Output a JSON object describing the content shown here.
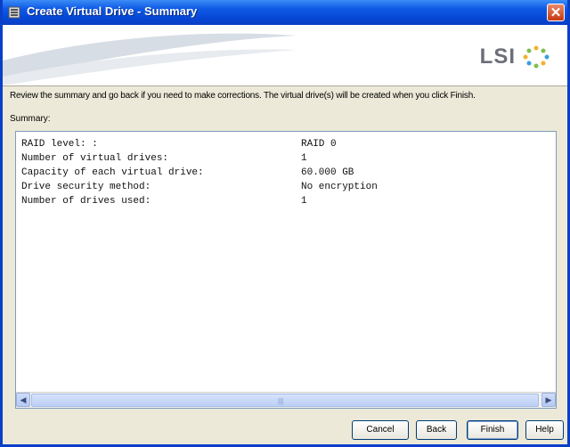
{
  "window": {
    "title": "Create Virtual Drive - Summary"
  },
  "banner": {
    "logo_text": "LSI"
  },
  "instruction": "Review the summary and go back if you need to make corrections. The virtual drive(s) will be created when you click Finish.",
  "summary_label": "Summary:",
  "summary": {
    "rows": [
      {
        "key": "RAID level: :",
        "value": "RAID 0"
      },
      {
        "key": "Number of virtual drives:",
        "value": "1"
      },
      {
        "key": "Capacity of each virtual drive:",
        "value": "60.000 GB"
      },
      {
        "key": "Drive security method:",
        "value": "No encryption"
      },
      {
        "key": "Number of drives used:",
        "value": "1"
      }
    ]
  },
  "buttons": {
    "cancel": "Cancel",
    "back": "Back",
    "finish": "Finish",
    "help": "Help"
  },
  "icons": {
    "title": "app-icon",
    "close": "close-icon",
    "scroll_left": "arrow-left-icon",
    "scroll_right": "arrow-right-icon"
  },
  "colors": {
    "titlebar": "#0648d6",
    "window_bg": "#ece9d8",
    "logo": "#6c6e78"
  }
}
